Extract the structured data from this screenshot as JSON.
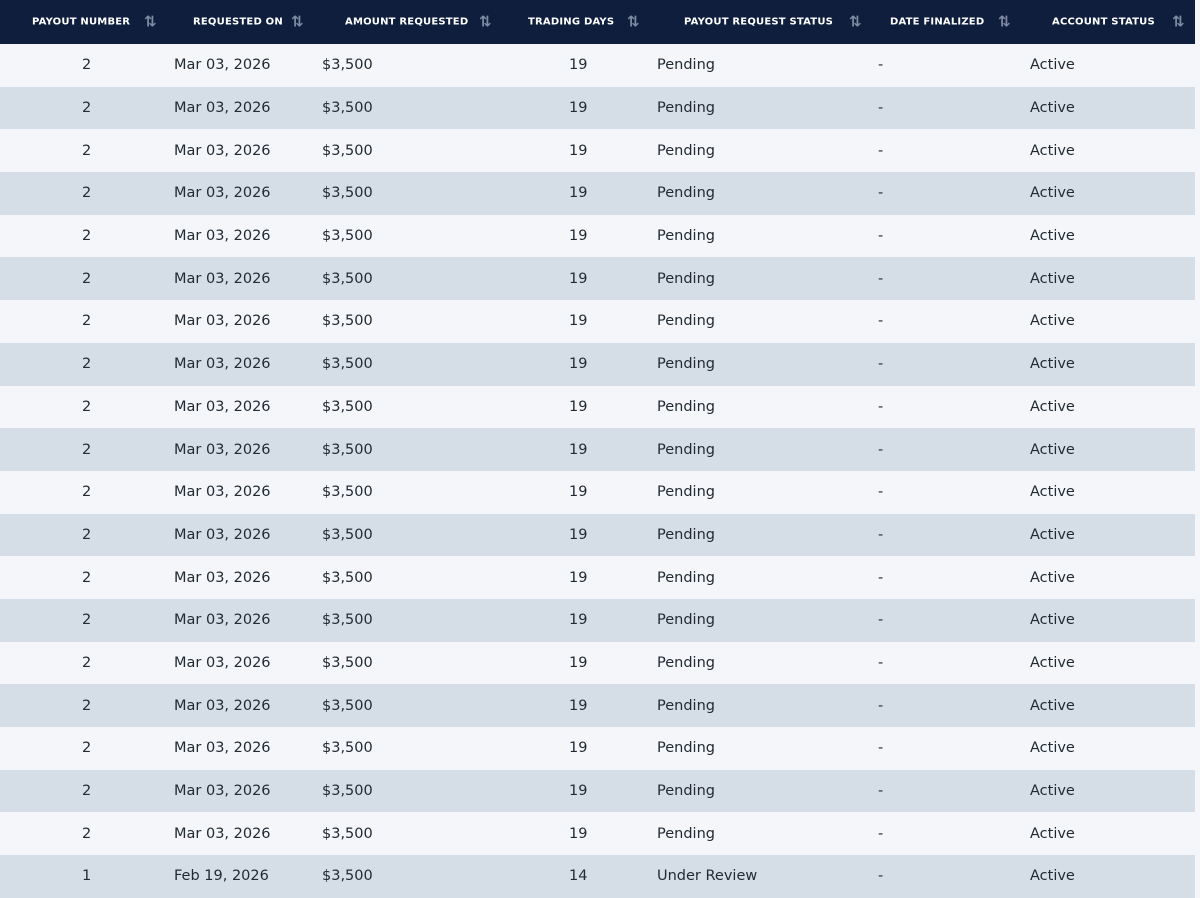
{
  "table": {
    "headers": [
      "Payout Number",
      "Requested On",
      "Amount Requested",
      "Trading Days",
      "Payout Request Status",
      "Date Finalized",
      "Account Status"
    ],
    "sort_icon": "sort-arrows-icon",
    "rows": [
      [
        "2",
        "Mar 03, 2026",
        "$3,500",
        "19",
        "Pending",
        "-",
        "Active"
      ],
      [
        "2",
        "Mar 03, 2026",
        "$3,500",
        "19",
        "Pending",
        "-",
        "Active"
      ],
      [
        "2",
        "Mar 03, 2026",
        "$3,500",
        "19",
        "Pending",
        "-",
        "Active"
      ],
      [
        "2",
        "Mar 03, 2026",
        "$3,500",
        "19",
        "Pending",
        "-",
        "Active"
      ],
      [
        "2",
        "Mar 03, 2026",
        "$3,500",
        "19",
        "Pending",
        "-",
        "Active"
      ],
      [
        "2",
        "Mar 03, 2026",
        "$3,500",
        "19",
        "Pending",
        "-",
        "Active"
      ],
      [
        "2",
        "Mar 03, 2026",
        "$3,500",
        "19",
        "Pending",
        "-",
        "Active"
      ],
      [
        "2",
        "Mar 03, 2026",
        "$3,500",
        "19",
        "Pending",
        "-",
        "Active"
      ],
      [
        "2",
        "Mar 03, 2026",
        "$3,500",
        "19",
        "Pending",
        "-",
        "Active"
      ],
      [
        "2",
        "Mar 03, 2026",
        "$3,500",
        "19",
        "Pending",
        "-",
        "Active"
      ],
      [
        "2",
        "Mar 03, 2026",
        "$3,500",
        "19",
        "Pending",
        "-",
        "Active"
      ],
      [
        "2",
        "Mar 03, 2026",
        "$3,500",
        "19",
        "Pending",
        "-",
        "Active"
      ],
      [
        "2",
        "Mar 03, 2026",
        "$3,500",
        "19",
        "Pending",
        "-",
        "Active"
      ],
      [
        "2",
        "Mar 03, 2026",
        "$3,500",
        "19",
        "Pending",
        "-",
        "Active"
      ],
      [
        "2",
        "Mar 03, 2026",
        "$3,500",
        "19",
        "Pending",
        "-",
        "Active"
      ],
      [
        "2",
        "Mar 03, 2026",
        "$3,500",
        "19",
        "Pending",
        "-",
        "Active"
      ],
      [
        "2",
        "Mar 03, 2026",
        "$3,500",
        "19",
        "Pending",
        "-",
        "Active"
      ],
      [
        "2",
        "Mar 03, 2026",
        "$3,500",
        "19",
        "Pending",
        "-",
        "Active"
      ],
      [
        "2",
        "Mar 03, 2026",
        "$3,500",
        "19",
        "Pending",
        "-",
        "Active"
      ],
      [
        "1",
        "Feb 19, 2026",
        "$3,500",
        "14",
        "Under Review",
        "-",
        "Active"
      ]
    ]
  },
  "colors": {
    "header_bg": "#0f1e3d",
    "row_light": "#f4f6f9",
    "row_dark": "#d5dde6"
  }
}
